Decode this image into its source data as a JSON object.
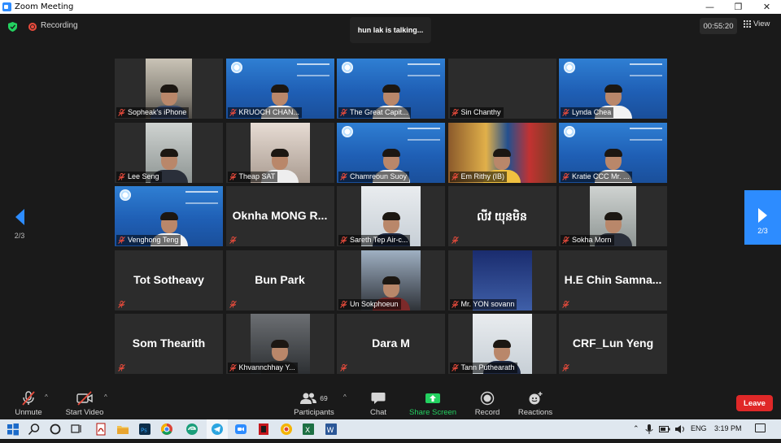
{
  "window": {
    "title": "Zoom Meeting",
    "controls": [
      "—",
      "❐",
      "✕"
    ]
  },
  "status": {
    "recording_label": "Recording",
    "speaking": "hun lak is talking...",
    "timer": "00:55:20",
    "view_label": "View"
  },
  "pagination": {
    "prev_page": "2/3",
    "next_page": "2/3"
  },
  "participants": [
    {
      "name": "Sopheak's iPhone",
      "display": "video",
      "bg": "room"
    },
    {
      "name": "KRUOCH CHAN...",
      "display": "video",
      "bg": "blue"
    },
    {
      "name": "The Great Capit...",
      "display": "video",
      "bg": "blue"
    },
    {
      "name": "Sin Chanthy",
      "display": "label"
    },
    {
      "name": "Lynda Chea",
      "display": "video",
      "bg": "blue"
    },
    {
      "name": "Lee Seng",
      "display": "video",
      "bg": "wall"
    },
    {
      "name": "Theap SAT",
      "display": "video",
      "bg": "skin"
    },
    {
      "name": "Chamreoun Suoy",
      "display": "video",
      "bg": "blue"
    },
    {
      "name": "Em Rithy (IB)",
      "display": "video",
      "bg": "flag"
    },
    {
      "name": "Kratie CCC Mr. ...",
      "display": "video",
      "bg": "blue"
    },
    {
      "name": "Venghong Teng",
      "display": "video",
      "bg": "blue"
    },
    {
      "name": "Oknha MONG R...",
      "display": "big"
    },
    {
      "name": "Sareth Tep Air-c...",
      "display": "video",
      "bg": "white"
    },
    {
      "name": "លីវ យុនមិន",
      "display": "big"
    },
    {
      "name": "Sokha Morn",
      "display": "video",
      "bg": "wall"
    },
    {
      "name": "Tot Sotheavy",
      "display": "big"
    },
    {
      "name": "Bun Park",
      "display": "big"
    },
    {
      "name": "Un Sokphoeun",
      "display": "video",
      "bg": "city"
    },
    {
      "name": "Mr. YON sovann",
      "display": "video",
      "bg": "poster"
    },
    {
      "name": "H.E Chin Samna...",
      "display": "big"
    },
    {
      "name": "Som Thearith",
      "display": "big"
    },
    {
      "name": "Khvannchhay Y...",
      "display": "video",
      "bg": "dark"
    },
    {
      "name": "Dara M",
      "display": "big"
    },
    {
      "name": "Tann Puthearath",
      "display": "video",
      "bg": "white"
    },
    {
      "name": "CRF_Lun Yeng",
      "display": "big"
    }
  ],
  "toolbar": {
    "unmute": "Unmute",
    "start_video": "Start Video",
    "participants": "Participants",
    "participants_count": "69",
    "chat": "Chat",
    "share_screen": "Share Screen",
    "record": "Record",
    "reactions": "Reactions",
    "leave": "Leave"
  },
  "taskbar": {
    "language": "ENG",
    "time": "3:19 PM"
  },
  "colors": {
    "accent": "#2d8cff",
    "share": "#23d160",
    "leave": "#e02828",
    "muted": "#e84b3c"
  }
}
